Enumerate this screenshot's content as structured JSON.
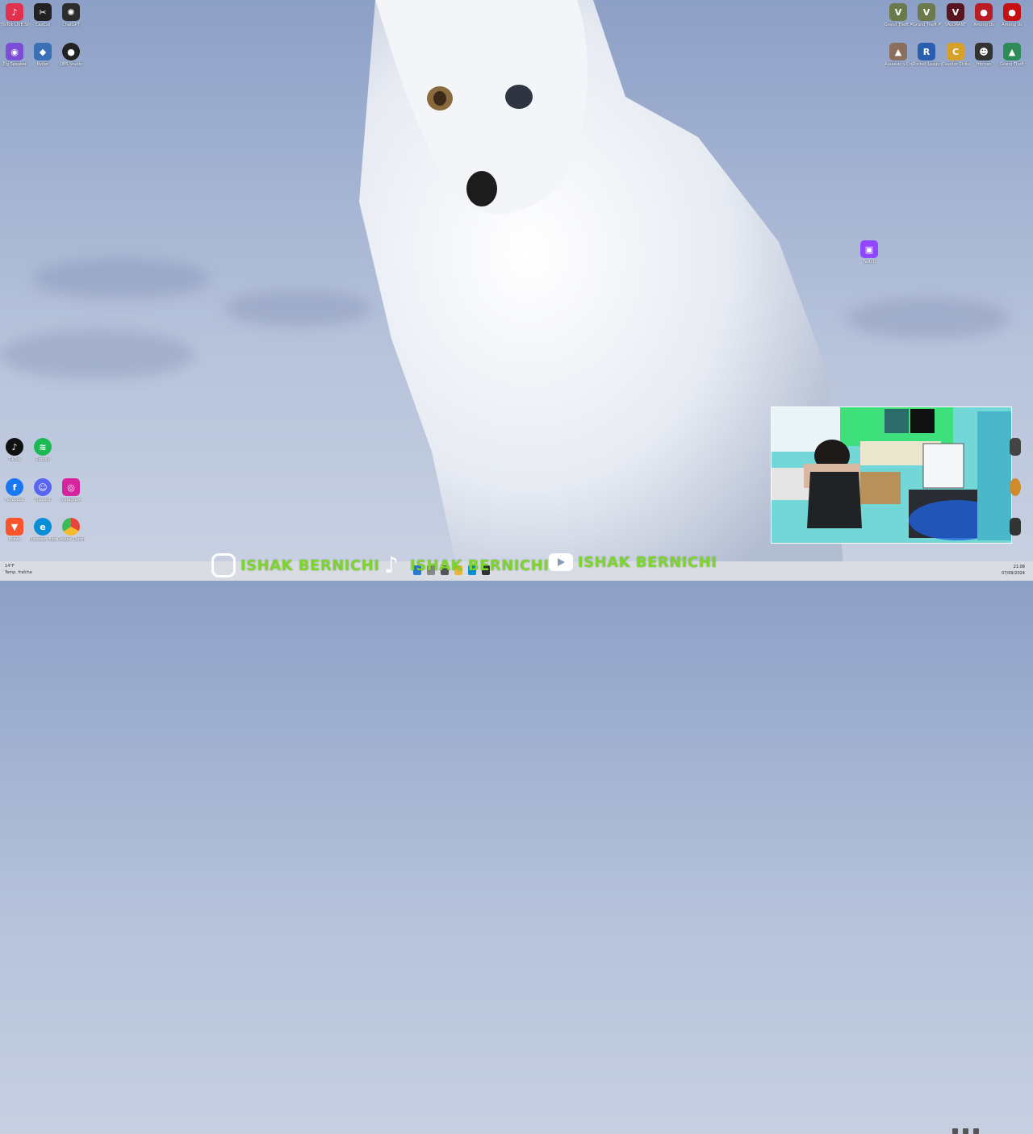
{
  "desktop": {
    "left_icons": [
      {
        "label": "TikTok LIVE Studio",
        "icon": "tiktok-live-icon",
        "color": "#e0314e"
      },
      {
        "label": "CapCut",
        "icon": "capcut-icon",
        "color": "#222222"
      },
      {
        "label": "ChatGPT",
        "icon": "chatgpt-icon",
        "color": "#2c2c2c"
      },
      {
        "label": "Zig Speaker",
        "icon": "app-icon",
        "color": "#7a4fd6"
      },
      {
        "label": "Ryder",
        "icon": "app-icon",
        "color": "#3b6fb6"
      },
      {
        "label": "OBS Studio",
        "icon": "obs-icon",
        "color": "#222222"
      },
      {
        "label": "TikTok",
        "icon": "tiktok-icon",
        "color": "#111111"
      },
      {
        "label": "Spotify",
        "icon": "spotify-icon",
        "color": "#1db954"
      },
      {
        "label": "Facebook",
        "icon": "facebook-icon",
        "color": "#1877f2"
      },
      {
        "label": "Discord",
        "icon": "discord-icon",
        "color": "#5865f2"
      },
      {
        "label": "Instagram",
        "icon": "instagram-icon",
        "color": "#d6249f"
      },
      {
        "label": "Brave",
        "icon": "brave-icon",
        "color": "#fb542b"
      },
      {
        "label": "Microsoft Edge",
        "icon": "edge-icon",
        "color": "#0a8fd6"
      },
      {
        "label": "Google Chrome",
        "icon": "chrome-icon",
        "color": "#e8453c"
      }
    ],
    "right_icons": [
      {
        "label": "Grand Theft Auto V",
        "icon": "gta-icon",
        "color": "#6b7a4a"
      },
      {
        "label": "Grand Theft Auto",
        "icon": "gta-icon",
        "color": "#6b7a4a"
      },
      {
        "label": "VALORANT",
        "icon": "valorant-icon",
        "color": "#5a1620"
      },
      {
        "label": "Among Us",
        "icon": "app-icon",
        "color": "#b81d24"
      },
      {
        "label": "Among Us",
        "icon": "amongus-icon",
        "color": "#c51111"
      },
      {
        "label": "Assassin's Creed",
        "icon": "app-icon",
        "color": "#8b6f5c"
      },
      {
        "label": "Rocket League",
        "icon": "rocketleague-icon",
        "color": "#2a5fb0"
      },
      {
        "label": "Counter-Strike",
        "icon": "cs-icon",
        "color": "#d6a12a"
      },
      {
        "label": "Hitman",
        "icon": "app-icon",
        "color": "#333333"
      },
      {
        "label": "Grand Theft",
        "icon": "app-icon",
        "color": "#2e8b57"
      }
    ],
    "mid_icon": {
      "label": "Twitch",
      "icon": "twitch-icon",
      "color": "#9146ff"
    },
    "right_edge_icons": [
      {
        "label": "",
        "icon": "app-icon"
      },
      {
        "label": "",
        "icon": "app-icon"
      },
      {
        "label": "",
        "icon": "app-icon"
      }
    ]
  },
  "overlay": {
    "social": [
      {
        "icon": "instagram-icon",
        "handle": "ISHAK BERNICHI"
      },
      {
        "icon": "tiktok-icon",
        "handle": "ISHAK BERNICHI"
      },
      {
        "icon": "youtube-icon",
        "handle": "ISHAK BERNICHI"
      }
    ],
    "accent_color": "#7bd62a"
  },
  "taskbar": {
    "weather_temp": "14°F",
    "weather_text": "Temp. fraîche",
    "time": "21:08",
    "date": "07/09/2024"
  }
}
